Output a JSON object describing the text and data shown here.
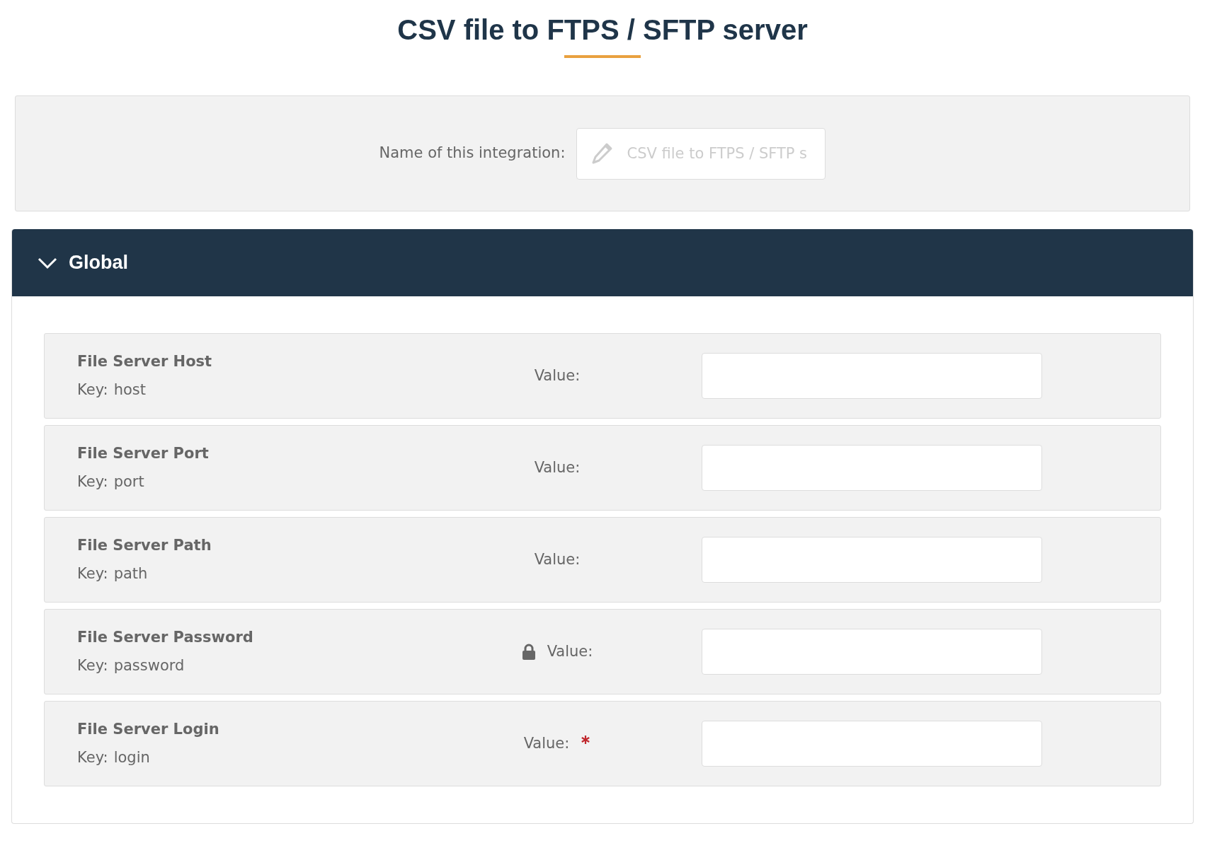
{
  "title": "CSV file to FTPS / SFTP server",
  "integration_name": {
    "label": "Name of this integration:",
    "placeholder": "CSV file to FTPS / SFTP s"
  },
  "section": {
    "title": "Global",
    "expanded": true,
    "fields": [
      {
        "name": "File Server Host",
        "key_label": "Key:",
        "key": "host",
        "value_label": "Value:",
        "secret": false,
        "required": false
      },
      {
        "name": "File Server Port",
        "key_label": "Key:",
        "key": "port",
        "value_label": "Value:",
        "secret": false,
        "required": false
      },
      {
        "name": "File Server Path",
        "key_label": "Key:",
        "key": "path",
        "value_label": "Value:",
        "secret": false,
        "required": false
      },
      {
        "name": "File Server Password",
        "key_label": "Key:",
        "key": "password",
        "value_label": "Value:",
        "secret": true,
        "required": false
      },
      {
        "name": "File Server Login",
        "key_label": "Key:",
        "key": "login",
        "value_label": "Value:",
        "secret": false,
        "required": true
      }
    ]
  }
}
